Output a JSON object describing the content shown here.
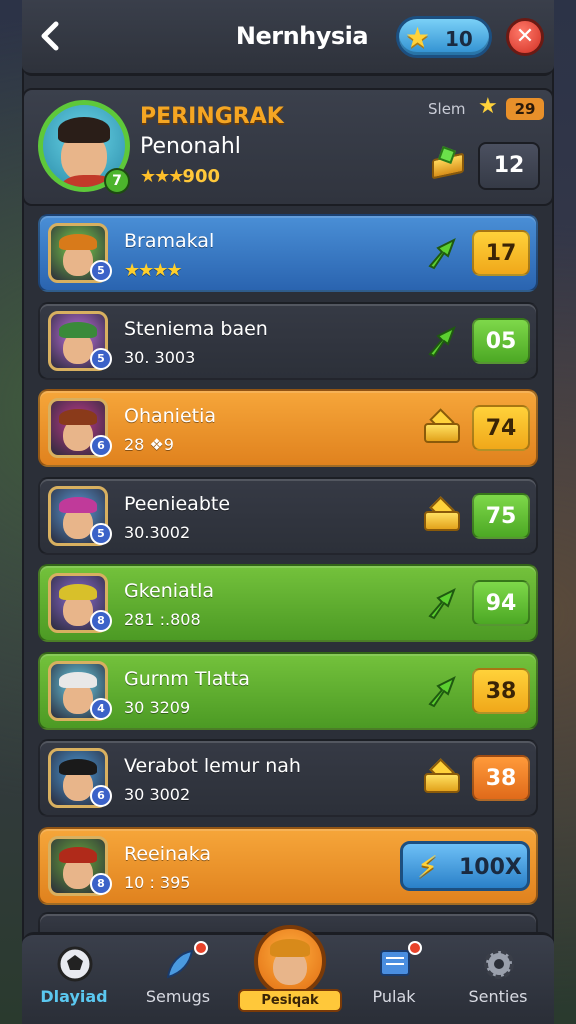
{
  "header": {
    "back_icon": "chevron-left-icon",
    "title": "Nernhysia",
    "stars": "10",
    "close_icon": "close-icon"
  },
  "profile": {
    "level": "7",
    "title": "PERINGRAK",
    "name": "Penonahl",
    "stars": "★★★",
    "score": "900",
    "stat_label": "Slem",
    "stat_value": "29",
    "rank": "12"
  },
  "leaderboard": [
    {
      "name": "Bramakal",
      "sub": "★★★★",
      "level": "5",
      "trend": "up",
      "score": "17",
      "color": "blue",
      "score_style": "yellow"
    },
    {
      "name": "Steniema baen",
      "sub": "30. 3003",
      "level": "5",
      "trend": "up",
      "score": "05",
      "color": "dark",
      "score_style": "green"
    },
    {
      "name": "Ohanietia",
      "sub": "28 ❖9",
      "level": "6",
      "trend": "crown",
      "score": "74",
      "color": "orange",
      "score_style": "yellow"
    },
    {
      "name": "Peenieabte",
      "sub": "30.3002",
      "level": "5",
      "trend": "crown",
      "score": "75",
      "color": "dark",
      "score_style": "green"
    },
    {
      "name": "Gkeniatla",
      "sub": "281 :.808",
      "level": "8",
      "trend": "up",
      "score": "94",
      "color": "green",
      "score_style": "green"
    },
    {
      "name": "Gurnm Tlatta",
      "sub": "30 3209",
      "level": "4",
      "trend": "up",
      "score": "38",
      "color": "green",
      "score_style": "yellow"
    },
    {
      "name": "Verabot lemur nah",
      "sub": "30 3002",
      "level": "6",
      "trend": "crown",
      "score": "38",
      "color": "dark",
      "score_style": "orange"
    },
    {
      "name": "Reeinaka",
      "sub": "10 : 395",
      "level": "8",
      "trend": "boost",
      "score": "100X",
      "color": "orange",
      "score_style": "boost"
    }
  ],
  "nav": {
    "items": [
      {
        "label": "Dlayiad",
        "icon": "soccer-ball-icon",
        "active": true
      },
      {
        "label": "Semugs",
        "icon": "feather-icon",
        "active": false
      },
      {
        "label": "Pesiqak",
        "icon": "avatar-icon",
        "active": false
      },
      {
        "label": "Pulak",
        "icon": "message-icon",
        "active": false
      },
      {
        "label": "Senties",
        "icon": "gear-icon",
        "active": false
      }
    ]
  },
  "colors": {
    "accent": "#5bc8f0",
    "gold": "#ffc83a",
    "panel": "#2b2f38"
  }
}
